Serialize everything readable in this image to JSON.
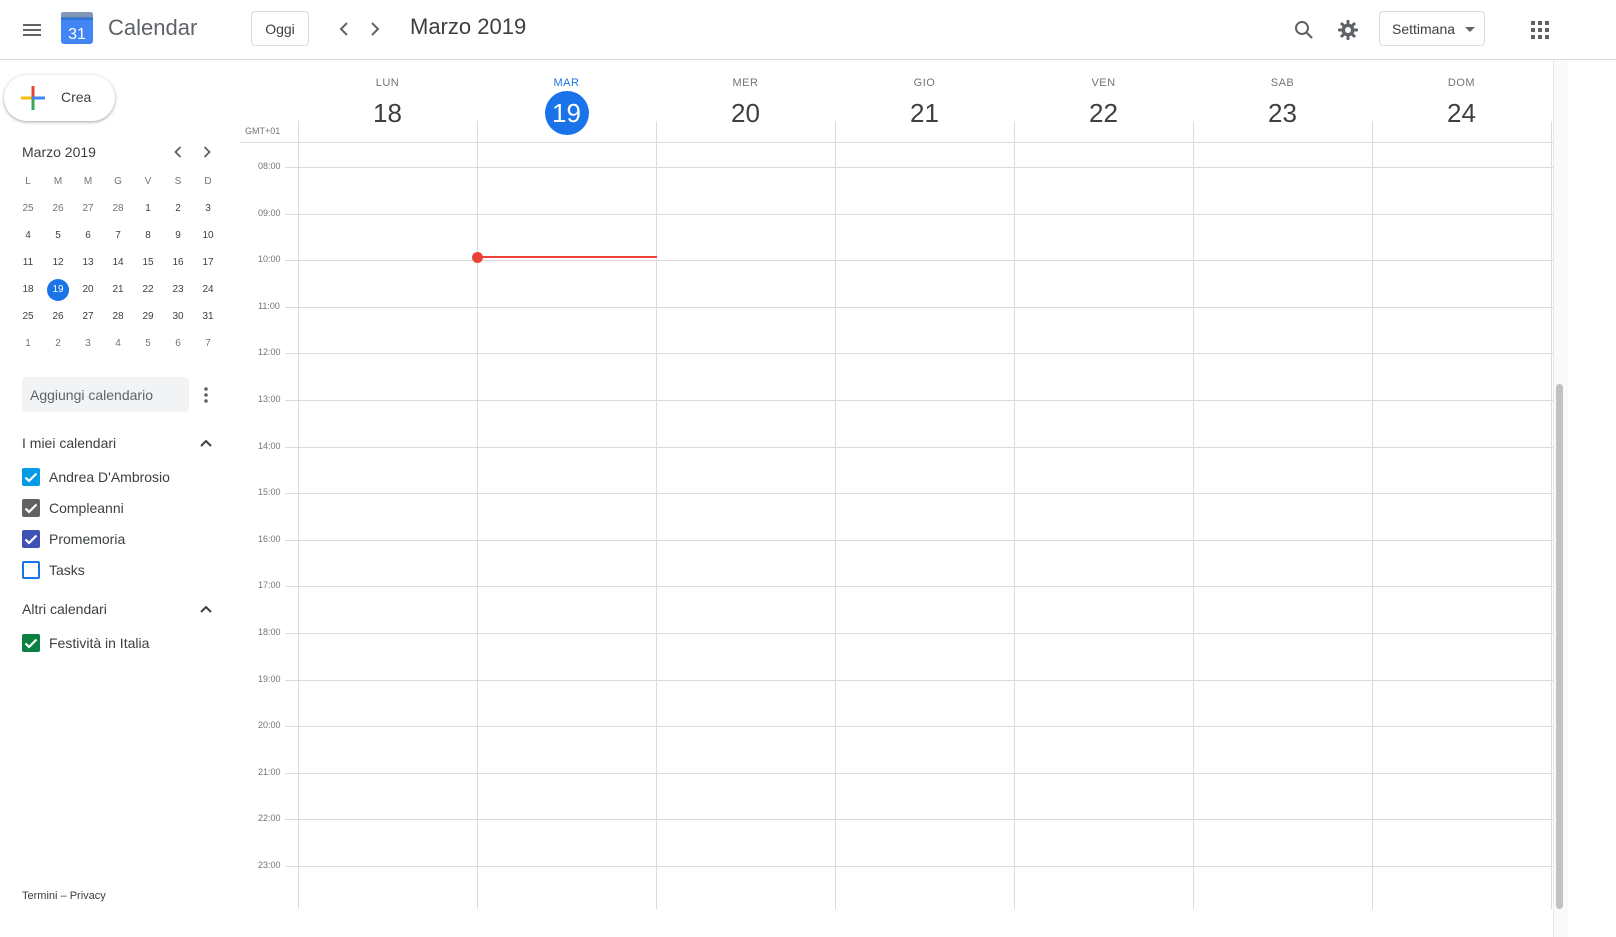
{
  "header": {
    "app_title": "Calendar",
    "logo_day": "31",
    "today_label": "Oggi",
    "period": "Marzo 2019",
    "view": "Settimana",
    "icons": [
      "menu-icon",
      "search-icon",
      "gear-icon",
      "apps-grid-icon",
      "chevron-left-icon",
      "chevron-right-icon"
    ]
  },
  "sidebar": {
    "create_label": "Crea",
    "mini_calendar": {
      "title": "Marzo 2019",
      "weekdays": [
        "L",
        "M",
        "M",
        "G",
        "V",
        "S",
        "D"
      ],
      "weeks": [
        [
          "25",
          "26",
          "27",
          "28",
          "1",
          "2",
          "3"
        ],
        [
          "4",
          "5",
          "6",
          "7",
          "8",
          "9",
          "10"
        ],
        [
          "11",
          "12",
          "13",
          "14",
          "15",
          "16",
          "17"
        ],
        [
          "18",
          "19",
          "20",
          "21",
          "22",
          "23",
          "24"
        ],
        [
          "25",
          "26",
          "27",
          "28",
          "29",
          "30",
          "31"
        ],
        [
          "1",
          "2",
          "3",
          "4",
          "5",
          "6",
          "7"
        ]
      ],
      "today": "19"
    },
    "add_calendar_placeholder": "Aggiungi calendario",
    "my_calendars": {
      "title": "I miei calendari",
      "items": [
        {
          "label": "Andrea D'Ambrosio",
          "checked": true,
          "color": "#039be5"
        },
        {
          "label": "Compleanni",
          "checked": true,
          "color": "#616161"
        },
        {
          "label": "Promemoria",
          "checked": true,
          "color": "#3f51b5"
        },
        {
          "label": "Tasks",
          "checked": false,
          "color": "#1a73e8"
        }
      ]
    },
    "other_calendars": {
      "title": "Altri calendari",
      "items": [
        {
          "label": "Festività in Italia",
          "checked": true,
          "color": "#0b8043"
        }
      ]
    },
    "footer": {
      "terms": "Termini",
      "separator": "–",
      "privacy": "Privacy"
    }
  },
  "week": {
    "timezone": "GMT+01",
    "days": [
      {
        "name": "LUN",
        "num": "18",
        "today": false
      },
      {
        "name": "MAR",
        "num": "19",
        "today": true
      },
      {
        "name": "MER",
        "num": "20",
        "today": false
      },
      {
        "name": "GIO",
        "num": "21",
        "today": false
      },
      {
        "name": "VEN",
        "num": "22",
        "today": false
      },
      {
        "name": "SAB",
        "num": "23",
        "today": false
      },
      {
        "name": "DOM",
        "num": "24",
        "today": false
      }
    ],
    "hours": [
      "08:00",
      "09:00",
      "10:00",
      "11:00",
      "12:00",
      "13:00",
      "14:00",
      "15:00",
      "16:00",
      "17:00",
      "18:00",
      "19:00",
      "20:00",
      "21:00",
      "22:00",
      "23:00"
    ]
  },
  "colors": {
    "accent": "#1a73e8",
    "now_indicator": "#ea4335"
  }
}
